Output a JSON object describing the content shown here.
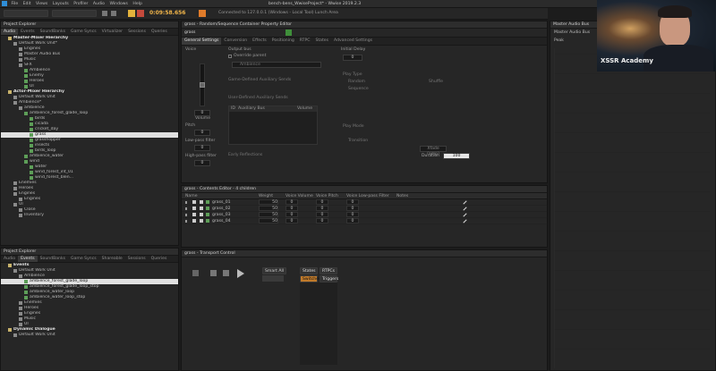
{
  "menu": [
    "File",
    "Edit",
    "Views",
    "Layouts",
    "Profiler",
    "Audio",
    "Windows",
    "Help"
  ],
  "toolbar": {
    "timecode": "0:09:58.656",
    "connection": "Connected to 127.0.0.1 (Windows - Local Tool) Lunch Area"
  },
  "window_title": "bench-bens_WwiseProject* - Wwise 2019.2.3",
  "project_explorer_top": {
    "title": "Project Explorer",
    "tabs": [
      "Audio",
      "Events",
      "SoundBanks",
      "Game Syncs",
      "Virtualizer",
      "Sessions",
      "Queries"
    ],
    "active_tab": "Audio",
    "rows": [
      {
        "label": "Master-Mixer Hierarchy",
        "indent": 1,
        "bold": true
      },
      {
        "label": "Default Work Unit*",
        "indent": 2
      },
      {
        "label": "Engines",
        "indent": 3
      },
      {
        "label": "Master Audio Bus",
        "indent": 3
      },
      {
        "label": "Music",
        "indent": 3
      },
      {
        "label": "SFX",
        "indent": 3
      },
      {
        "label": "Ambience",
        "indent": 4
      },
      {
        "label": "Enemy",
        "indent": 4
      },
      {
        "label": "Heroes",
        "indent": 4
      },
      {
        "label": "UI",
        "indent": 4
      },
      {
        "label": "Actor-Mixer Hierarchy",
        "indent": 1,
        "bold": true
      },
      {
        "label": "Default Work Unit",
        "indent": 2
      },
      {
        "label": "Ambience*",
        "indent": 2
      },
      {
        "label": "ambience",
        "indent": 3
      },
      {
        "label": "ambience_forest_glade_loop",
        "indent": 4
      },
      {
        "label": "birds",
        "indent": 5
      },
      {
        "label": "cicada",
        "indent": 5
      },
      {
        "label": "cricket_day",
        "indent": 5
      },
      {
        "label": "grass",
        "indent": 5,
        "selected": true
      },
      {
        "label": "grasshopper",
        "indent": 5
      },
      {
        "label": "insects",
        "indent": 5
      },
      {
        "label": "birds_loop",
        "indent": 5
      },
      {
        "label": "ambience_water",
        "indent": 4
      },
      {
        "label": "wind",
        "indent": 4
      },
      {
        "label": "water",
        "indent": 5
      },
      {
        "label": "wind_forest_int_01",
        "indent": 5
      },
      {
        "label": "wind_forest_blen...",
        "indent": 5
      },
      {
        "label": "Enemies",
        "indent": 2
      },
      {
        "label": "Heroes",
        "indent": 2
      },
      {
        "label": "Engines",
        "indent": 2
      },
      {
        "label": "Engines",
        "indent": 3
      },
      {
        "label": "UI",
        "indent": 2
      },
      {
        "label": "Close",
        "indent": 3
      },
      {
        "label": "Inventory",
        "indent": 3
      }
    ]
  },
  "project_explorer_bottom": {
    "title": "Project Explorer",
    "tabs": [
      "Audio",
      "Events",
      "SoundBanks",
      "Game Syncs",
      "Shareable",
      "Sessions",
      "Queries"
    ],
    "active_tab": "Events",
    "rows": [
      {
        "label": "Events",
        "indent": 1,
        "bold": true
      },
      {
        "label": "Default Work Unit",
        "indent": 2
      },
      {
        "label": "Ambience",
        "indent": 3
      },
      {
        "label": "ambience_forest_glade_loop",
        "indent": 4,
        "selected": true
      },
      {
        "label": "ambience_forest_glade_loop_stop",
        "indent": 4
      },
      {
        "label": "ambience_water_loop",
        "indent": 4
      },
      {
        "label": "ambience_water_loop_stop",
        "indent": 4
      },
      {
        "label": "Enemies",
        "indent": 3
      },
      {
        "label": "Heroes",
        "indent": 3
      },
      {
        "label": "Engines",
        "indent": 3
      },
      {
        "label": "Music",
        "indent": 3
      },
      {
        "label": "UI",
        "indent": 3
      },
      {
        "label": "Dynamic Dialogue",
        "indent": 1,
        "bold": true
      },
      {
        "label": "Default Work Unit",
        "indent": 2
      }
    ]
  },
  "property_editor": {
    "title": "grass - Random/Sequence Container Property Editor",
    "object_name": "grass",
    "tabs": [
      "General Settings",
      "Conversion",
      "Effects",
      "Positioning",
      "RTPC",
      "States",
      "Advanced Settings"
    ],
    "active_tab": "General Settings",
    "voice_label": "Voice",
    "volume_label": "Volume",
    "volume_value": "0",
    "pitch_label": "Pitch",
    "pitch_value": "0",
    "lowpass_label": "Low-pass filter",
    "lowpass_value": "0",
    "highpass_label": "High-pass filter",
    "highpass_value": "0",
    "output_bus_label": "Output bus",
    "override_parent": "Override parent",
    "output_bus_value": "Ambience",
    "game_aux_label": "Game-Defined Auxiliary Sends",
    "user_aux_label": "User-Defined Auxiliary Sends",
    "aux_col1": "ID",
    "aux_col2": "Auxiliary Bus",
    "aux_col3": "Volume",
    "early_reflections": "Early Reflections",
    "initial_delay_label": "Initial Delay",
    "initial_delay_value": "0",
    "play_type": "Play Type",
    "play_mode": "Play Mode",
    "transition": "Transition",
    "duration_label": "Duration",
    "duration_value": "100",
    "xfade": "Xfade (amp)",
    "random_label": "Random",
    "sequence_label": "Sequence",
    "shuffle_label": "Shuffle"
  },
  "contents_editor": {
    "title": "grass - Contents Editor - 4 children",
    "columns": [
      "Name",
      "Weight",
      "Voice Volume",
      "Voice Pitch",
      "Voice Low-pass Filter",
      "Notes"
    ],
    "rows": [
      {
        "name": "grass_01",
        "weight": "50",
        "volume": "0",
        "pitch": "0",
        "lpf": "0"
      },
      {
        "name": "grass_02",
        "weight": "50",
        "volume": "0",
        "pitch": "0",
        "lpf": "0"
      },
      {
        "name": "grass_03",
        "weight": "50",
        "volume": "0",
        "pitch": "0",
        "lpf": "0"
      },
      {
        "name": "grass_04",
        "weight": "50",
        "volume": "0",
        "pitch": "0",
        "lpf": "0"
      }
    ]
  },
  "transport": {
    "title": "grass - Transport Control",
    "states_label": "States",
    "rtpcs_label": "RTPCs",
    "switches_label": "Switches",
    "triggers_label": "Triggers",
    "mode_label": "Smart All"
  },
  "meter": {
    "title": "Master Audio Bus",
    "sub": "Master Audio Bus",
    "peak_label": "Peak",
    "ticks": [
      "-6",
      "-12",
      "-18",
      "-24",
      "-30",
      "-36",
      "-42",
      "-48",
      "-54",
      "-60",
      "-66",
      "-72",
      "-78",
      "-84",
      "-90",
      "-96"
    ]
  },
  "webcam": {
    "caption": "XSSR Academy"
  }
}
